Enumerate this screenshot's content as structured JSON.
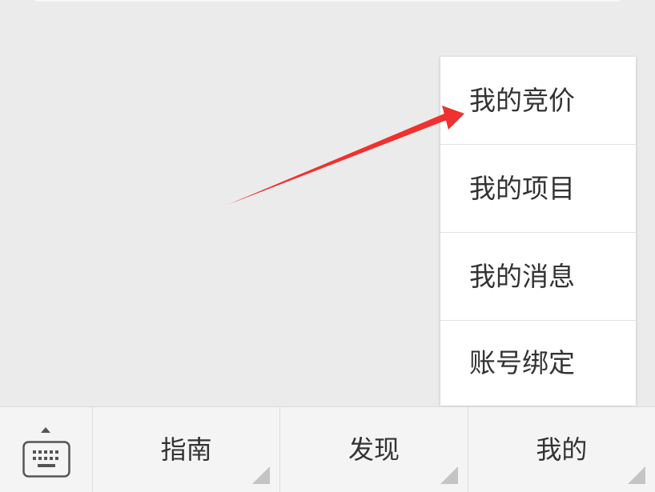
{
  "popup_menu": {
    "items": [
      {
        "label": "我的竞价"
      },
      {
        "label": "我的项目"
      },
      {
        "label": "我的消息"
      },
      {
        "label": "账号绑定"
      }
    ]
  },
  "bottom_bar": {
    "keyboard_icon": "keyboard-icon",
    "tabs": [
      {
        "label": "指南"
      },
      {
        "label": "发现"
      },
      {
        "label": "我的"
      }
    ]
  },
  "colors": {
    "background": "#ebebeb",
    "annotation_arrow": "#f0312f",
    "menu_background": "#ffffff",
    "text": "#333333"
  }
}
